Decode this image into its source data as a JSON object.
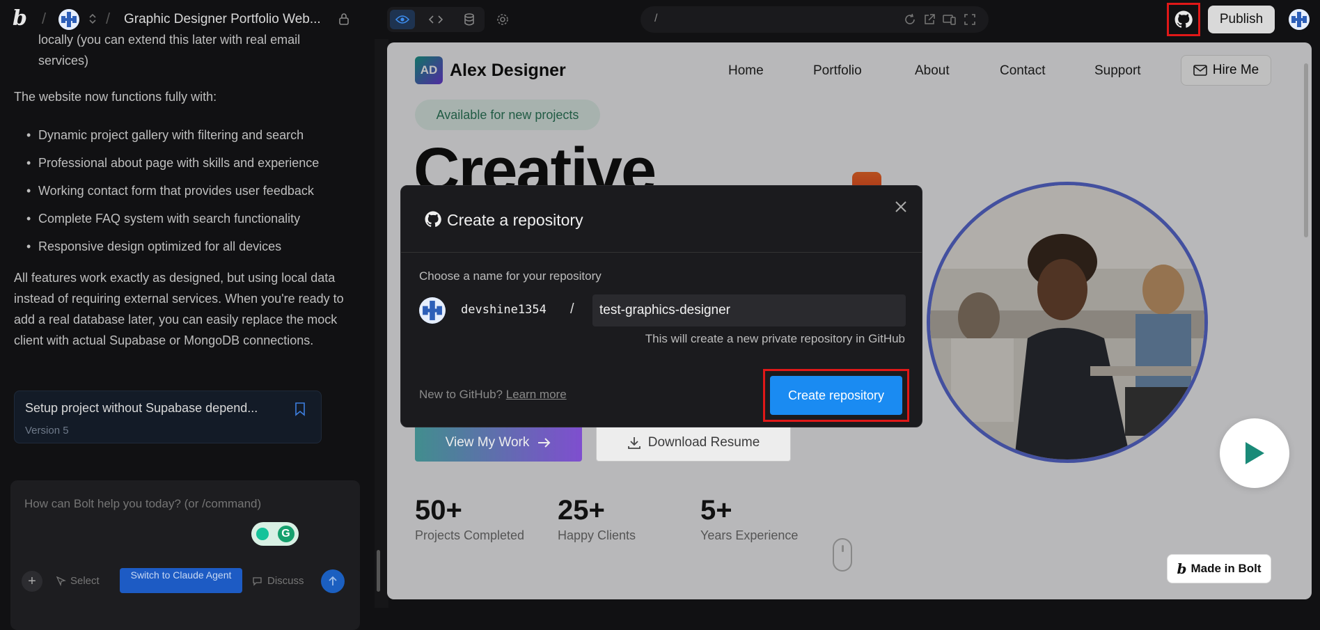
{
  "topbar": {
    "project_title": "Graphic Designer Portfolio Web...",
    "url": "/",
    "publish_label": "Publish"
  },
  "sidebar": {
    "intro_partial": "locally (you can extend this later with real email services)",
    "functions_heading": "The website now functions fully with:",
    "bullets": [
      "Dynamic project gallery with filtering and search",
      "Professional about page with skills and experience",
      "Working contact form that provides user feedback",
      "Complete FAQ system with search functionality",
      "Responsive design optimized for all devices"
    ],
    "closing": "All features work exactly as designed, but using local data instead of requiring external services. When you're ready to add a real database later, you can easily replace the mock client with actual Supabase or MongoDB connections.",
    "version_card": {
      "title": "Setup project without Supabase depend...",
      "version": "Version 5"
    },
    "prompt": {
      "placeholder": "How can Bolt help you today? (or /command)",
      "select_label": "Select",
      "switch_label": "Switch to Claude Agent",
      "discuss_label": "Discuss"
    }
  },
  "preview": {
    "brand_initials": "AD",
    "brand_name": "Alex Designer",
    "nav": [
      "Home",
      "Portfolio",
      "About",
      "Contact",
      "Support"
    ],
    "hire_label": "Hire Me",
    "badge": "Available for new projects",
    "headline": "Creative",
    "cta_primary": "View My Work",
    "cta_secondary": "Download Resume",
    "stats": [
      {
        "value": "50+",
        "label": "Projects Completed"
      },
      {
        "value": "25+",
        "label": "Happy Clients"
      },
      {
        "value": "5+",
        "label": "Years Experience"
      }
    ],
    "made_in_bolt": "Made in Bolt"
  },
  "modal": {
    "title": "Create a repository",
    "choose_label": "Choose a name for your repository",
    "owner": "devshine1354",
    "separator": "/",
    "repo_name": "test-graphics-designer",
    "hint": "This will create a new private repository in GitHub",
    "new_to_github": "New to GitHub?",
    "learn_more": "Learn more",
    "create_label": "Create repository"
  },
  "colors": {
    "accent_blue": "#1a8bf2",
    "highlight_red": "#e01818",
    "badge_green": "#2d7a5b"
  }
}
